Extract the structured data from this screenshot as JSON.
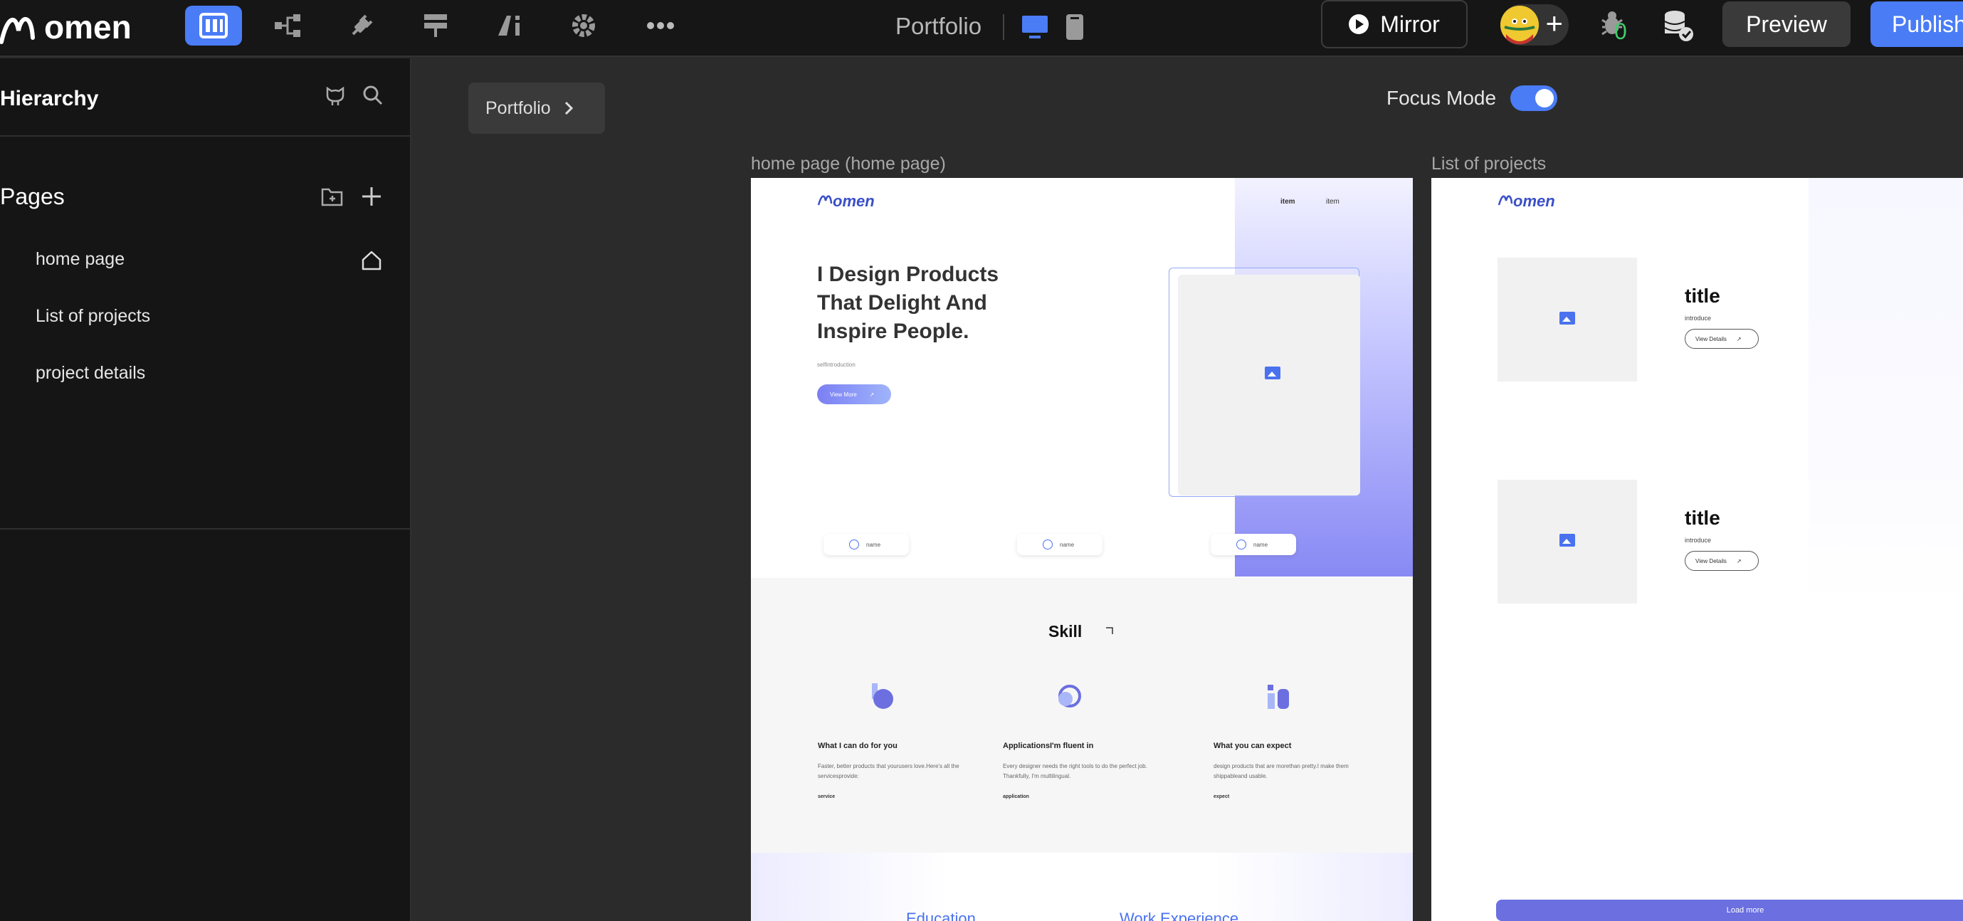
{
  "app": {
    "logo_text": "omen",
    "doc_title": "Portfolio",
    "mirror_label": "Mirror",
    "bug_count": "0",
    "preview_label": "Preview",
    "publish_label": "Publish",
    "accent_color": "#4a7cf6"
  },
  "toolbar": {
    "icons": [
      "pages-icon",
      "hierarchy-icon",
      "plugin-icon",
      "layout-icon",
      "ai-icon",
      "gear-icon",
      "more-icon"
    ]
  },
  "sidebar": {
    "title": "Hierarchy",
    "pages_title": "Pages",
    "pages": [
      {
        "label": "home page",
        "is_home": true
      },
      {
        "label": "List of projects",
        "is_home": false
      },
      {
        "label": "project details",
        "is_home": false
      }
    ]
  },
  "canvas": {
    "breadcrumb": "Portfolio",
    "focus_mode_label": "Focus Mode",
    "focus_mode_on": true,
    "frames": [
      {
        "label": "home page (home page)"
      },
      {
        "label": "List of projects"
      }
    ]
  },
  "home_frame": {
    "logo": "omen",
    "nav": [
      "item",
      "item"
    ],
    "hero_title": "I Design Products That Delight And Inspire People.",
    "hero_sub": "selfintroduction",
    "hero_button": "View More",
    "names": [
      "name",
      "name",
      "name"
    ],
    "skill_title": "Skill",
    "skills": [
      {
        "heading": "What I can do for you",
        "text": "Faster, better products that yourusers love.Here's all the servicesprovide:",
        "tag": "service"
      },
      {
        "heading": "ApplicationsI'm fluent in",
        "text": "Every designer needs the right tools to do the perfect job. Thankfully, I'm multilingual.",
        "tag": "application"
      },
      {
        "heading": "What you can expect",
        "text": "design products that are morethan pretty.I make them shippableand usable.",
        "tag": "expect"
      }
    ],
    "education": "Education",
    "work": "Work Experience"
  },
  "projects_frame": {
    "logo": "omen",
    "items": [
      {
        "title": "title",
        "intro": "introduce",
        "button": "View Details"
      },
      {
        "title": "title",
        "intro": "introduce",
        "button": "View Details"
      }
    ],
    "load_more": "Load more"
  }
}
